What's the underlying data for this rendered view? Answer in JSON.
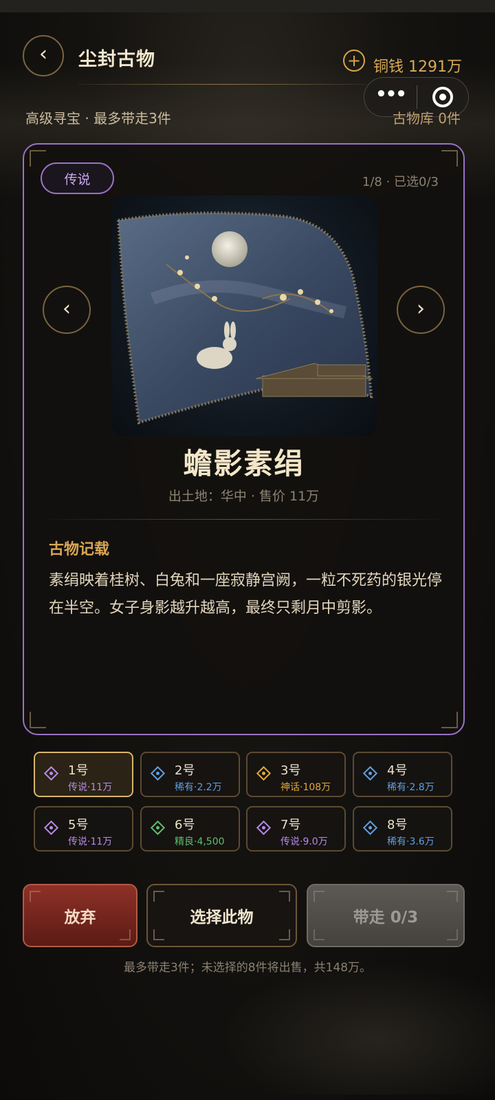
{
  "header": {
    "back_glyph": "‹",
    "title": "尘封古物",
    "currency_label": "铜钱 1291万",
    "subtitle_left": "高级寻宝 · 最多带走3件",
    "subtitle_right": "古物库 0件"
  },
  "capsule": {
    "more_glyph": "•••"
  },
  "card": {
    "rarity": "传说",
    "counter": "1/8 · 已选0/3",
    "prev_glyph": "‹",
    "next_glyph": "›",
    "item_name": "蟾影素绢",
    "item_meta": "出土地：华中 · 售价 11万",
    "record_title": "古物记载",
    "record_text": "素绢映着桂树、白兔和一座寂静宫阙，一粒不死药的银光停在半空。女子身影越升越高，最终只剩月中剪影。"
  },
  "grid": [
    {
      "num": "1号",
      "tag": "传说·11万",
      "color": "#b68ae6",
      "selected": true
    },
    {
      "num": "2号",
      "tag": "稀有·2.2万",
      "color": "#5f9fe0",
      "selected": false
    },
    {
      "num": "3号",
      "tag": "神话·108万",
      "color": "#e0a83c",
      "selected": false
    },
    {
      "num": "4号",
      "tag": "稀有·2.8万",
      "color": "#5f9fe0",
      "selected": false
    },
    {
      "num": "5号",
      "tag": "传说·11万",
      "color": "#b68ae6",
      "selected": false
    },
    {
      "num": "6号",
      "tag": "精良·4,500",
      "color": "#5fbf6e",
      "selected": false
    },
    {
      "num": "7号",
      "tag": "传说·9.0万",
      "color": "#b68ae6",
      "selected": false
    },
    {
      "num": "8号",
      "tag": "稀有·3.6万",
      "color": "#5f9fe0",
      "selected": false
    }
  ],
  "buttons": {
    "abandon": "放弃",
    "select": "选择此物",
    "take": "带走 0/3"
  },
  "footer_note": "最多带走3件；未选择的8件将出售，共148万。"
}
